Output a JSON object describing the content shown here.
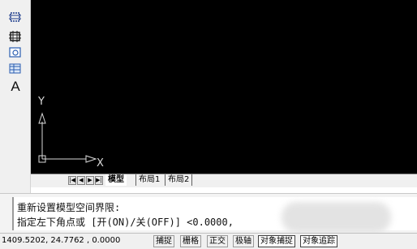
{
  "toolbar": {
    "items": [
      {
        "icon": "rectangle-dashed-icon"
      },
      {
        "icon": "rectangle-solid-icon"
      },
      {
        "icon": "region-icon"
      },
      {
        "icon": "table-icon"
      }
    ],
    "text_tool": "A"
  },
  "canvas": {
    "background": "#000000",
    "ucs": {
      "y_label": "Y",
      "x_label": "X"
    }
  },
  "tabs": {
    "nav": [
      "|◀",
      "◀",
      "▶",
      "▶|"
    ],
    "items": [
      "模型",
      "布局1",
      "布局2"
    ],
    "active": "模型"
  },
  "command": {
    "line1": "重新设置模型空间界限:",
    "line2": "指定左下角点或 [开(ON)/关(OFF)] <0.0000,"
  },
  "status": {
    "coords": "1409.5202, 24.7762  , 0.0000",
    "buttons": [
      "捕捉",
      "栅格",
      "正交",
      "极轴",
      "对象捕捉",
      "对象追踪"
    ]
  }
}
